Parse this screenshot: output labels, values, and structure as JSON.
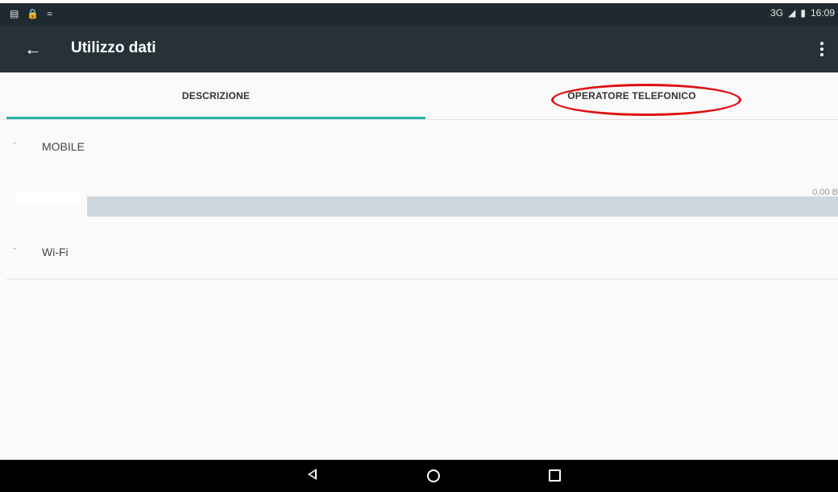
{
  "status_bar": {
    "network": "3G",
    "time": "16:09"
  },
  "toolbar": {
    "title": "Utilizzo dati"
  },
  "tabs": [
    {
      "label": "DESCRIZIONE",
      "selected": true
    },
    {
      "label": "OPERATORE TELEFONICO",
      "selected": false
    }
  ],
  "sections": {
    "mobile": {
      "label": "MOBILE",
      "usage": "0,00 B"
    },
    "wifi": {
      "label": "Wi-Fi"
    }
  },
  "colors": {
    "toolbar": "#263238",
    "status_bar": "#1f2a30",
    "tab_indicator": "#2bb3a5",
    "annotation": "#e01010",
    "usage_bar": "#d0d8de"
  }
}
